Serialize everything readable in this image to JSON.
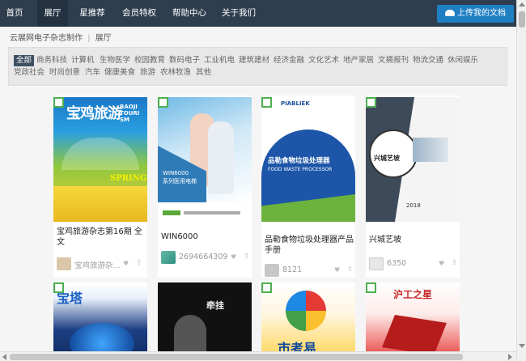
{
  "nav": {
    "items": [
      {
        "label": "首页"
      },
      {
        "label": "展厅"
      },
      {
        "label": "星推荐"
      },
      {
        "label": "会员特权"
      },
      {
        "label": "帮助中心"
      },
      {
        "label": "关于我们"
      }
    ],
    "upload_label": "上传我的文档"
  },
  "breadcrumb": {
    "root": "云展网电子杂志制作",
    "sep": "|",
    "current": "展厅"
  },
  "categories": {
    "row1": [
      "全部",
      "商务科技",
      "计算机",
      "生物医学",
      "校园教育",
      "数码电子",
      "工业机电",
      "建筑建材",
      "经济金融",
      "文化艺术",
      "地产家居",
      "文摘报刊",
      "物流交通",
      "休闲娱乐"
    ],
    "row2": [
      "党政社会",
      "时尚创意",
      "汽车",
      "健康美食",
      "旅游",
      "农林牧渔",
      "其他"
    ]
  },
  "cards": [
    {
      "title": "宝鸡旅游杂志第16期 全文",
      "author": "宝鸡旅游杂...",
      "cover_text_main": "宝鸡旅游",
      "cover_text_sub": "BAOJI TOURISM",
      "cover_text_spring": "SPRING"
    },
    {
      "title": "WIN6000",
      "views": "2694664309",
      "cover_text": "WIN6000",
      "cover_subtext": "系列医用电梯"
    },
    {
      "title": "品勒食物垃圾处理器产品手册",
      "views": "8121",
      "cover_brand": "PIABLIEK",
      "cover_title": "品勒食物垃圾处理器",
      "cover_subtitle": "FOOD WASTE PROCESSOR"
    },
    {
      "title": "兴城艺坡",
      "views": "6350",
      "cover_text": "兴城艺坡",
      "cover_year": "2018"
    }
  ],
  "bottom_cards": [
    {
      "cover_text": "宝塔"
    },
    {
      "cover_text": "牵挂"
    },
    {
      "cover_text": "市考易"
    },
    {
      "cover_text": "沪工之星"
    }
  ],
  "colors": {
    "nav_bg": "#2f3e4e",
    "upload_bg": "#1f7fc3",
    "qr_green": "#4caf50"
  }
}
